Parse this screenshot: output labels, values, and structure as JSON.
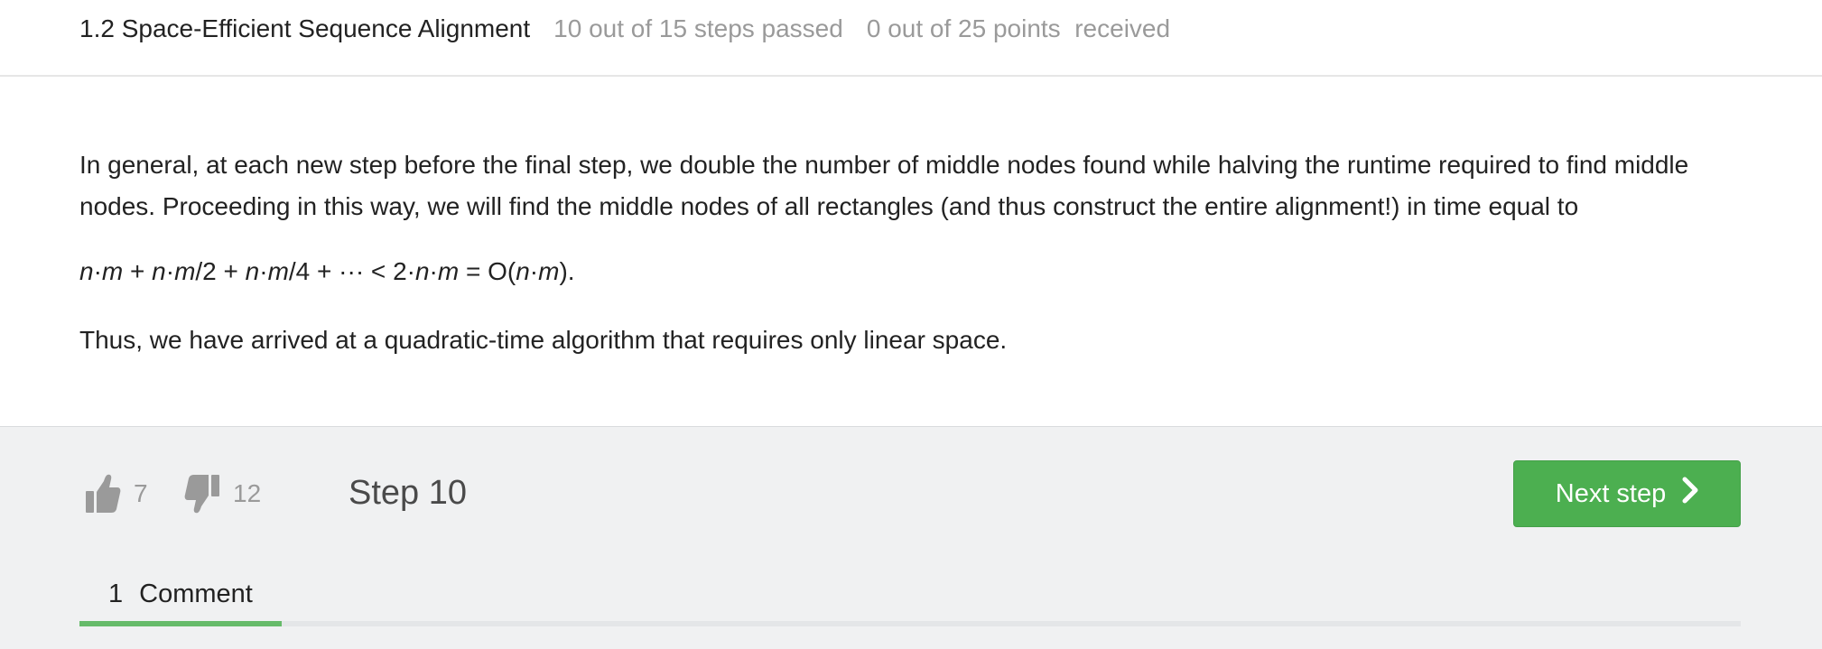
{
  "header": {
    "lesson_title": "1.2 Space-Efficient Sequence Alignment",
    "steps_progress": "10 out of 15 steps passed",
    "points_progress": "0 out of 25 points  received"
  },
  "content": {
    "paragraph1": "In general, at each new step before the final step, we double the number of middle nodes found while halving the runtime required to find middle nodes. Proceeding in this way, we will find the middle nodes of all rectangles (and thus construct the entire alignment!) in time equal to",
    "formula": {
      "n": "n",
      "m": "m",
      "dot": "·",
      "div2": "/2",
      "div4": "/4",
      "plus": " + ",
      "ellipsis_lt": " + ··· < ",
      "two": "2",
      "eq_O": " = O(",
      "close": ")."
    },
    "paragraph3": "Thus, we have arrived at a quadratic-time algorithm that requires only linear space."
  },
  "footer": {
    "likes": "7",
    "dislikes": "12",
    "step_label": "Step 10",
    "next_button_label": "Next step",
    "comments_count": "1",
    "comments_label": "Comment"
  },
  "colors": {
    "accent_green": "#4caf50",
    "tab_active": "#66bb6a",
    "muted_text": "#9a9a9a"
  },
  "icons": [
    "thumbs-up-icon",
    "thumbs-down-icon",
    "chevron-right-icon"
  ]
}
